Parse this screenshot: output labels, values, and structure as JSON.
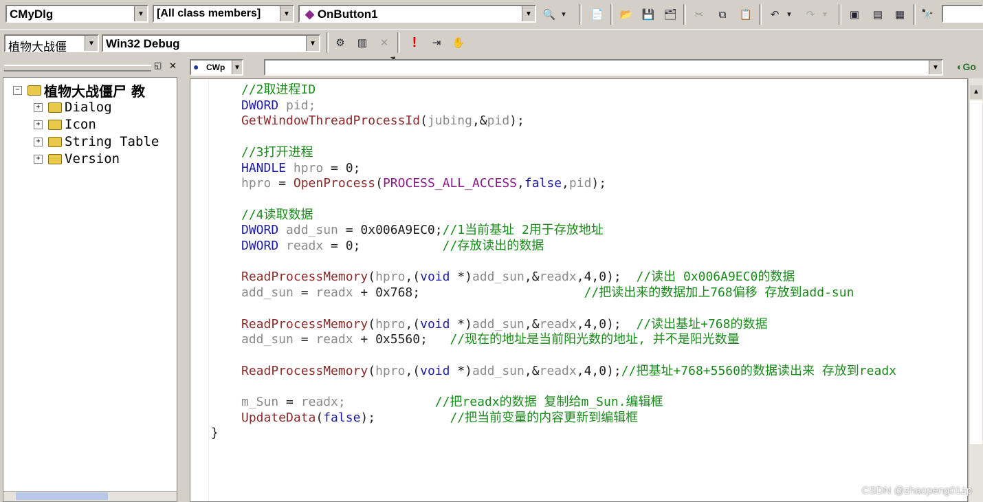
{
  "toolbar1": {
    "class_combo": "CMyDlg",
    "filter_combo": "[All class members]",
    "member_combo": "OnButton1"
  },
  "toolbar2": {
    "project_combo": "植物大战僵",
    "config_combo": "Win32 Debug"
  },
  "editor_toolbar": {
    "wizard_label": "CWp",
    "go_label": "Go"
  },
  "tree": {
    "root": "植物大战僵尸  教",
    "children": [
      "Dialog",
      "Icon",
      "String Table",
      "Version"
    ]
  },
  "code": {
    "lines": [
      [
        [
          "cm",
          "//2取进程ID"
        ]
      ],
      [
        [
          "kw",
          "DWORD"
        ],
        [
          "id",
          " pid;"
        ]
      ],
      [
        [
          "fn",
          "GetWindowThreadProcessId"
        ],
        [
          "op",
          "("
        ],
        [
          "id",
          "jubing"
        ],
        [
          "op",
          ",&"
        ],
        [
          "id",
          "pid"
        ],
        [
          "op",
          ");"
        ]
      ],
      [],
      [
        [
          "cm",
          "//3打开进程"
        ]
      ],
      [
        [
          "kw",
          "HANDLE"
        ],
        [
          "id",
          " hpro"
        ],
        [
          "op",
          " = 0;"
        ]
      ],
      [
        [
          "id",
          "hpro"
        ],
        [
          "op",
          " = "
        ],
        [
          "fn",
          "OpenProcess"
        ],
        [
          "op",
          "("
        ],
        [
          "mac",
          "PROCESS_ALL_ACCESS"
        ],
        [
          "op",
          ","
        ],
        [
          "kw",
          "false"
        ],
        [
          "op",
          ","
        ],
        [
          "id",
          "pid"
        ],
        [
          "op",
          ");"
        ]
      ],
      [],
      [
        [
          "cm",
          "//4读取数据"
        ]
      ],
      [
        [
          "kw",
          "DWORD"
        ],
        [
          "id",
          " add_sun"
        ],
        [
          "op",
          " = 0x006A9EC0;"
        ],
        [
          "cm",
          "//1当前基址 2用于存放地址"
        ]
      ],
      [
        [
          "kw",
          "DWORD"
        ],
        [
          "id",
          " readx"
        ],
        [
          "op",
          " = 0;"
        ],
        [
          "op",
          "           "
        ],
        [
          "cm",
          "//存放读出的数据"
        ]
      ],
      [],
      [
        [
          "fn",
          "ReadProcessMemory"
        ],
        [
          "op",
          "("
        ],
        [
          "id",
          "hpro"
        ],
        [
          "op",
          ",("
        ],
        [
          "kw",
          "void"
        ],
        [
          "op",
          " *)"
        ],
        [
          "id",
          "add_sun"
        ],
        [
          "op",
          ",&"
        ],
        [
          "id",
          "readx"
        ],
        [
          "op",
          ",4,0);  "
        ],
        [
          "cm",
          "//读出 0x006A9EC0的数据"
        ]
      ],
      [
        [
          "id",
          "add_sun"
        ],
        [
          "op",
          " = "
        ],
        [
          "id",
          "readx"
        ],
        [
          "op",
          " + 0x768;"
        ],
        [
          "op",
          "                      "
        ],
        [
          "cm",
          "//把读出来的数据加上768偏移 存放到add-sun"
        ]
      ],
      [],
      [
        [
          "fn",
          "ReadProcessMemory"
        ],
        [
          "op",
          "("
        ],
        [
          "id",
          "hpro"
        ],
        [
          "op",
          ",("
        ],
        [
          "kw",
          "void"
        ],
        [
          "op",
          " *)"
        ],
        [
          "id",
          "add_sun"
        ],
        [
          "op",
          ",&"
        ],
        [
          "id",
          "readx"
        ],
        [
          "op",
          ",4,0);  "
        ],
        [
          "cm",
          "//读出基址+768的数据"
        ]
      ],
      [
        [
          "id",
          "add_sun"
        ],
        [
          "op",
          " = "
        ],
        [
          "id",
          "readx"
        ],
        [
          "op",
          " + 0x5560;"
        ],
        [
          "op",
          "   "
        ],
        [
          "cm",
          "//现在的地址是当前阳光数的地址, 并不是阳光数量"
        ]
      ],
      [],
      [
        [
          "fn",
          "ReadProcessMemory"
        ],
        [
          "op",
          "("
        ],
        [
          "id",
          "hpro"
        ],
        [
          "op",
          ",("
        ],
        [
          "kw",
          "void"
        ],
        [
          "op",
          " *)"
        ],
        [
          "id",
          "add_sun"
        ],
        [
          "op",
          ",&"
        ],
        [
          "id",
          "readx"
        ],
        [
          "op",
          ",4,0);"
        ],
        [
          "cm",
          "//把基址+768+5560的数据读出来 存放到readx"
        ]
      ],
      [],
      [
        [
          "id",
          "m_Sun"
        ],
        [
          "op",
          " = "
        ],
        [
          "id",
          "readx;"
        ],
        [
          "op",
          "            "
        ],
        [
          "cm",
          "//把readx的数据 复制给m_Sun.编辑框"
        ]
      ],
      [
        [
          "fn",
          "UpdateData"
        ],
        [
          "op",
          "("
        ],
        [
          "kw",
          "false"
        ],
        [
          "op",
          ");"
        ],
        [
          "op",
          "          "
        ],
        [
          "cm",
          "//把当前变量的内容更新到编辑框"
        ]
      ],
      [
        [
          "op",
          "}"
        ]
      ]
    ]
  },
  "watermark": "CSDN @zhaopeng01zp"
}
